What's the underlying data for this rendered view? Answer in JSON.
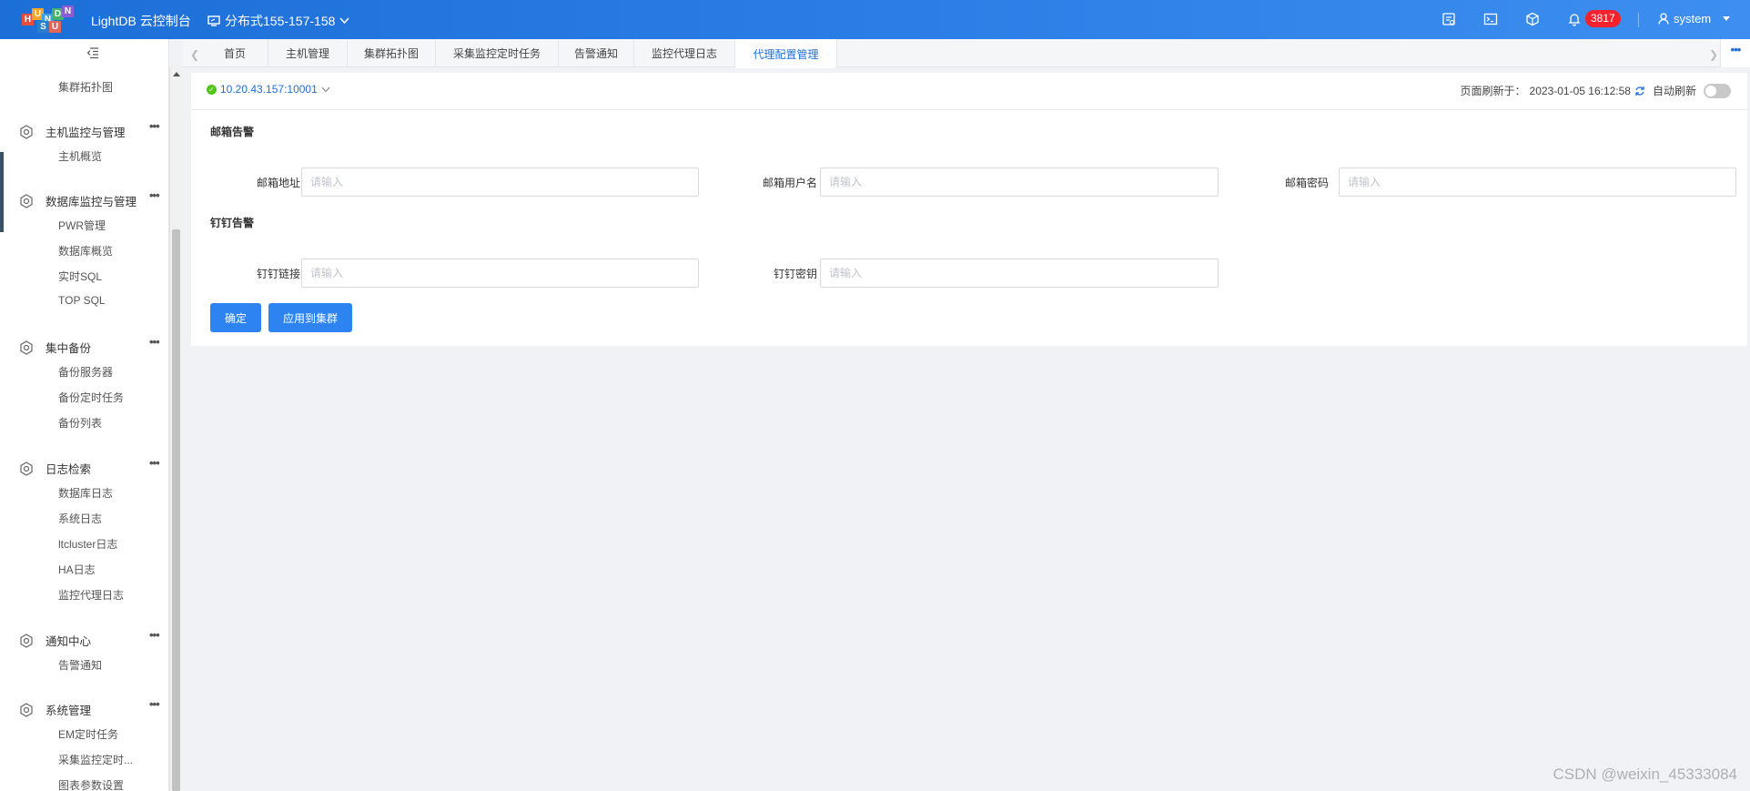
{
  "app": {
    "title": "LightDB 云控制台",
    "cluster_name": "分布式155-157-158",
    "logo_letters": [
      "H",
      "U",
      "N",
      "D",
      "S",
      "U",
      "N"
    ],
    "notification_count": "3817",
    "user": "system"
  },
  "sidebar": {
    "top_item": "集群拓扑图",
    "groups": [
      {
        "title": "主机监控与管理",
        "items": [
          "主机概览"
        ]
      },
      {
        "title": "数据库监控与管理",
        "items": [
          "PWR管理",
          "数据库概览",
          "实时SQL",
          "TOP SQL"
        ]
      },
      {
        "title": "集中备份",
        "items": [
          "备份服务器",
          "备份定时任务",
          "备份列表"
        ]
      },
      {
        "title": "日志检索",
        "items": [
          "数据库日志",
          "系统日志",
          "ltcluster日志",
          "HA日志",
          "监控代理日志"
        ]
      },
      {
        "title": "通知中心",
        "items": [
          "告警通知"
        ]
      },
      {
        "title": "系统管理",
        "items": [
          "EM定时任务",
          "采集监控定时...",
          "图表参数设置"
        ]
      }
    ]
  },
  "tabs": [
    "首页",
    "主机管理",
    "集群拓扑图",
    "采集监控定时任务",
    "告警通知",
    "监控代理日志",
    "代理配置管理"
  ],
  "active_tab": "代理配置管理",
  "panel": {
    "node": "10.20.43.157:10001",
    "refresh_label": "页面刷新于：",
    "refresh_time": "2023-01-05 16:12:58",
    "auto_refresh_label": "自动刷新",
    "auto_refresh": false,
    "email_section": "邮箱告警",
    "email_address_label": "邮箱地址",
    "email_user_label": "邮箱用户名",
    "email_password_label": "邮箱密码",
    "dingtalk_section": "钉钉告警",
    "dingtalk_link_label": "钉钉链接",
    "dingtalk_secret_label": "钉钉密钥",
    "placeholder": "请输入",
    "confirm_button": "确定",
    "apply_button": "应用到集群"
  },
  "watermark": "CSDN @weixin_45333084",
  "colors": {
    "header": "#1d6fd8",
    "primary": "#2d84f0",
    "badge": "#f5222d",
    "success": "#52c41a"
  }
}
